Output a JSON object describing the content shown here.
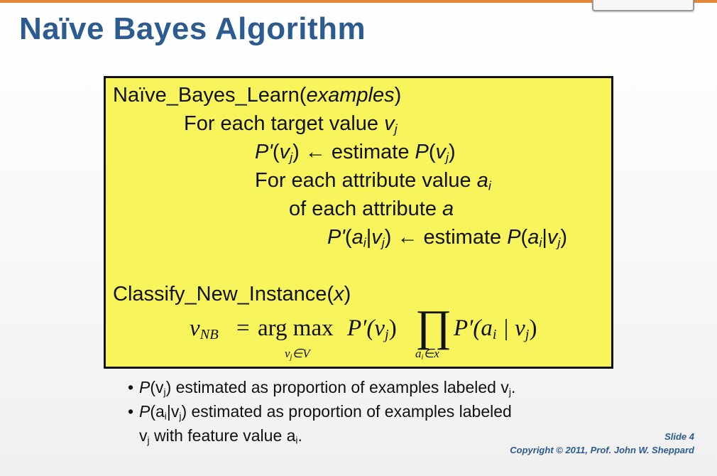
{
  "slide": {
    "title": "Naïve Bayes Algorithm",
    "toolbar_button_label": "",
    "slide_number": "Slide 4",
    "copyright": "Copyright © 2011, Prof. John W. Sheppard"
  },
  "algorithm": {
    "learn_name": "Naïve_Bayes_Learn(",
    "learn_arg": "examples",
    "learn_close": ")",
    "for_target_prefix": "For each target value ",
    "var_v": "v",
    "sub_j": "j",
    "sub_i": "i",
    "p_prime": "P'",
    "p": "P",
    "paren_open": "(",
    "paren_close": ")",
    "arrow_estimate": " ← estimate ",
    "for_attr_prefix": "For each attribute value ",
    "var_a": "a",
    "of_each_attr_prefix": "of each attribute ",
    "bar": "|",
    "classify_name": "Classify_New_Instance(",
    "classify_arg": "x",
    "classify_close": ")"
  },
  "formula": {
    "lhs": "v",
    "lhs_sub": "NB",
    "eq": "=",
    "argmax": "arg max",
    "argmax_under": "v",
    "argmax_under_sub": "j",
    "argmax_under_set": "∈V",
    "term1": "P′(v",
    "term1_sub": "j",
    "term1_close": ")",
    "prod": "∏",
    "prod_under": "a",
    "prod_under_sub": "i",
    "prod_under_set": "∈x",
    "term2": "P′(a",
    "term2_sub_i": "i",
    "term2_mid": " | v",
    "term2_sub_j": "j",
    "term2_close": ")"
  },
  "bullets": {
    "dot": "•",
    "b1_p": "P",
    "b1_open": "(v",
    "b1_sub": "j",
    "b1_text": ") estimated as proportion of examples labeled v",
    "b1_end_sub": "j",
    "b1_end": ".",
    "b2_p": "P",
    "b2_open": "(a",
    "b2_sub_i": "i",
    "b2_mid": "|v",
    "b2_sub_j": "j",
    "b2_text": ") estimated as proportion of examples labeled",
    "b3_v": "v",
    "b3_sub": "j",
    "b3_text": " with feature value a",
    "b3_end_sub": "i",
    "b3_end": "."
  },
  "colors": {
    "title": "#2b5b8f",
    "box_fill": "#f8f45c",
    "top_rule": "#e0893a"
  }
}
